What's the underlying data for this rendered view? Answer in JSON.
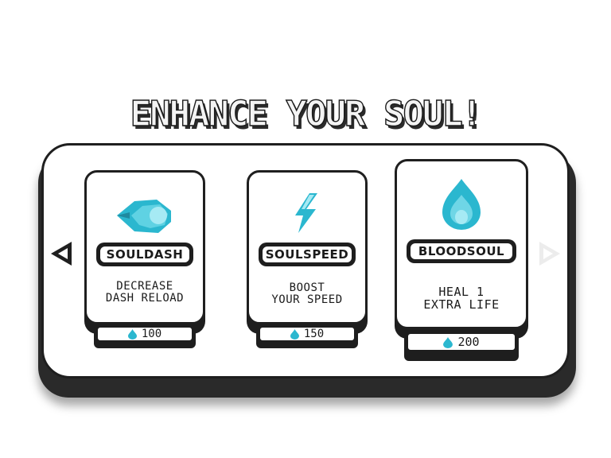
{
  "title": "ENHANCE YOUR SOUL!",
  "colors": {
    "soul_accent": "#2bb7cf",
    "soul_light": "#a6eaf4",
    "outline": "#1f1f1f"
  },
  "nav": {
    "prev_icon": "triangle-left-icon",
    "next_icon": "triangle-right-icon"
  },
  "cards": [
    {
      "name": "SOULDASH",
      "desc_line1": "DECREASE",
      "desc_line2": "DASH RELOAD",
      "price": "100",
      "icon": "soul-dash-icon"
    },
    {
      "name": "SOULSPEED",
      "desc_line1": "BOOST",
      "desc_line2": "YOUR SPEED",
      "price": "150",
      "icon": "lightning-icon"
    },
    {
      "name": "BLOODSOUL",
      "desc_line1": "HEAL 1",
      "desc_line2": "EXTRA LIFE",
      "price": "200",
      "icon": "soul-flame-icon"
    }
  ]
}
